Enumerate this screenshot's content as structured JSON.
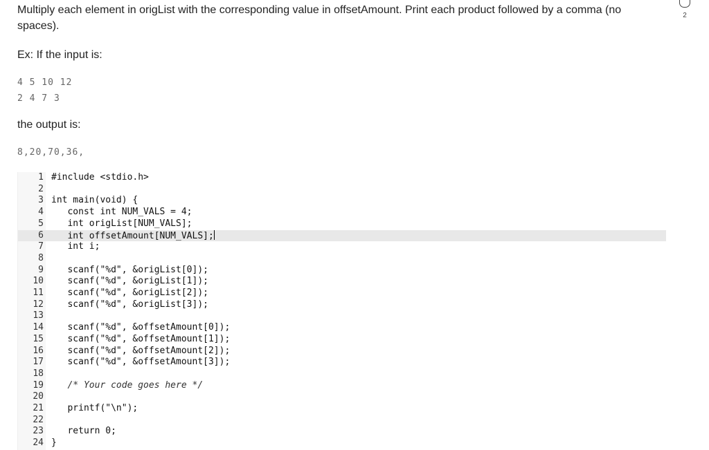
{
  "prompt": "Multiply each element in origList with the corresponding value in offsetAmount. Print each product followed by a comma (no spaces).",
  "example_label": "Ex: If the input is:",
  "input_lines": [
    "4 5 10 12",
    "2 4 7 3"
  ],
  "output_label": "the output is:",
  "output_line": "8,20,70,36,",
  "badge_count": "2",
  "editor": {
    "active_line": 6,
    "lines": [
      {
        "n": "1",
        "text": "#include <stdio.h>"
      },
      {
        "n": "2",
        "text": ""
      },
      {
        "n": "3",
        "text": "int main(void) {"
      },
      {
        "n": "4",
        "text": "   const int NUM_VALS = 4;"
      },
      {
        "n": "5",
        "text": "   int origList[NUM_VALS];"
      },
      {
        "n": "6",
        "text": "   int offsetAmount[NUM_VALS];"
      },
      {
        "n": "7",
        "text": "   int i;"
      },
      {
        "n": "8",
        "text": ""
      },
      {
        "n": "9",
        "text": "   scanf(\"%d\", &origList[0]);"
      },
      {
        "n": "10",
        "text": "   scanf(\"%d\", &origList[1]);"
      },
      {
        "n": "11",
        "text": "   scanf(\"%d\", &origList[2]);"
      },
      {
        "n": "12",
        "text": "   scanf(\"%d\", &origList[3]);"
      },
      {
        "n": "13",
        "text": ""
      },
      {
        "n": "14",
        "text": "   scanf(\"%d\", &offsetAmount[0]);"
      },
      {
        "n": "15",
        "text": "   scanf(\"%d\", &offsetAmount[1]);"
      },
      {
        "n": "16",
        "text": "   scanf(\"%d\", &offsetAmount[2]);"
      },
      {
        "n": "17",
        "text": "   scanf(\"%d\", &offsetAmount[3]);"
      },
      {
        "n": "18",
        "text": ""
      },
      {
        "n": "19",
        "text": "   /* Your code goes here */"
      },
      {
        "n": "20",
        "text": ""
      },
      {
        "n": "21",
        "text": "   printf(\"\\n\");"
      },
      {
        "n": "22",
        "text": ""
      },
      {
        "n": "23",
        "text": "   return 0;"
      },
      {
        "n": "24",
        "text": "}"
      }
    ]
  }
}
